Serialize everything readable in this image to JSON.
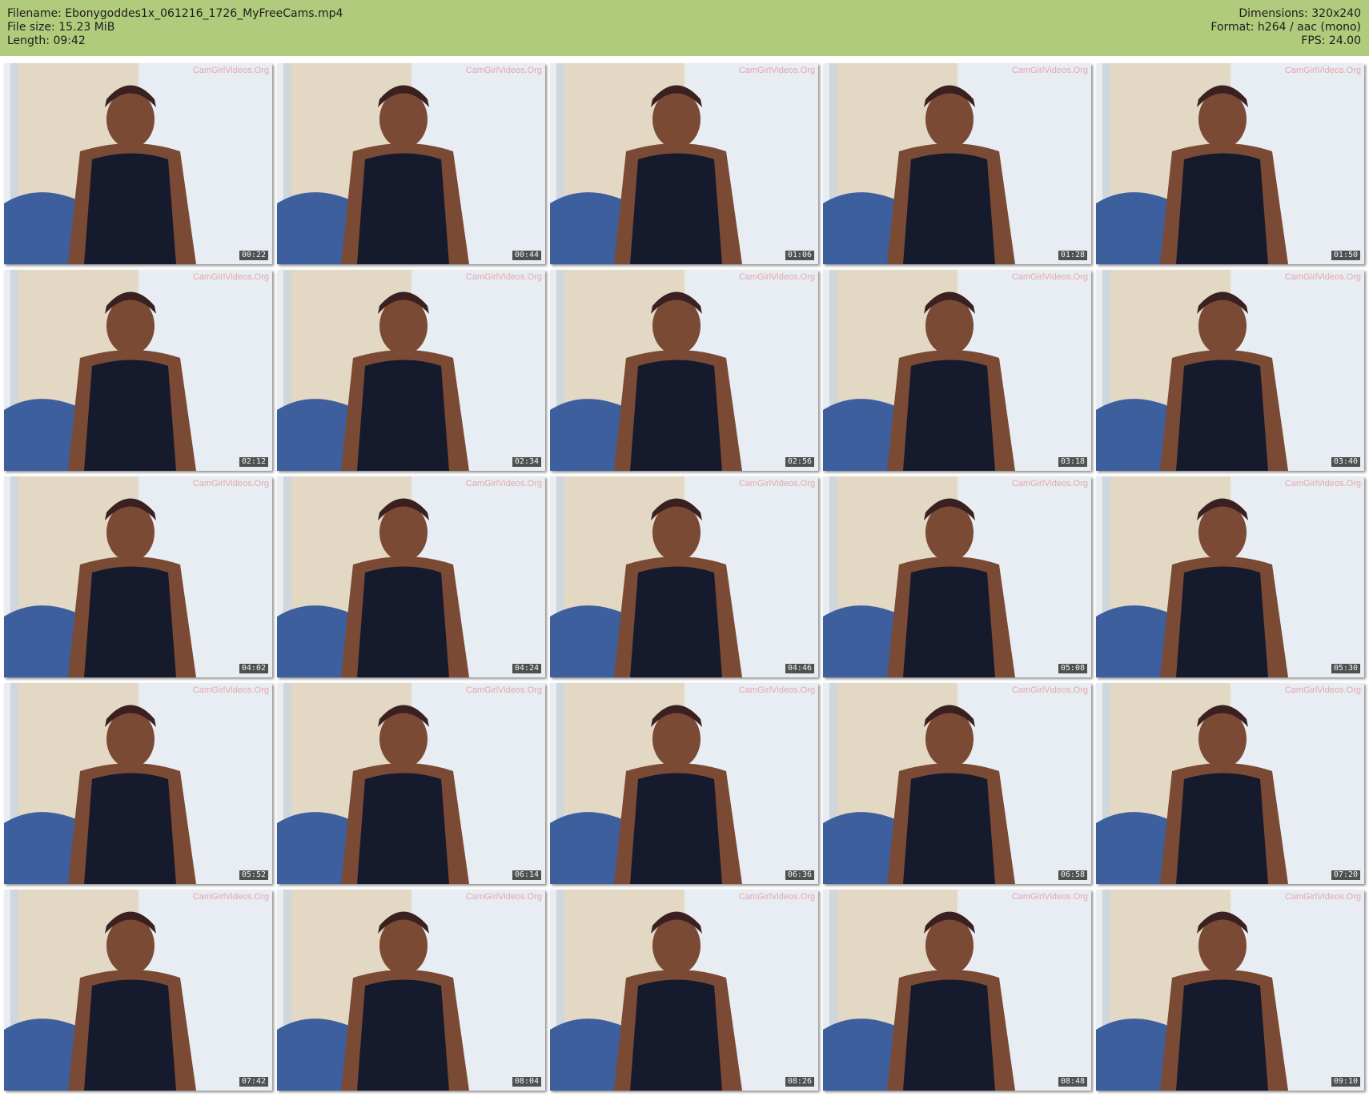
{
  "header": {
    "filename": "Filename: Ebonygoddes1x_061216_1726_MyFreeCams.mp4",
    "filesize": "File size: 15.23 MiB",
    "length": "Length: 09:42",
    "dimensions": "Dimensions: 320x240",
    "format": "Format: h264 / aac (mono)",
    "fps": "FPS: 24.00",
    "background_color": "#b0cb7c"
  },
  "watermark": "CamGirlVideos.Org",
  "thumbnails": [
    {
      "timestamp": "00:22"
    },
    {
      "timestamp": "00:44"
    },
    {
      "timestamp": "01:06"
    },
    {
      "timestamp": "01:28"
    },
    {
      "timestamp": "01:50"
    },
    {
      "timestamp": "02:12"
    },
    {
      "timestamp": "02:34"
    },
    {
      "timestamp": "02:56"
    },
    {
      "timestamp": "03:18"
    },
    {
      "timestamp": "03:40"
    },
    {
      "timestamp": "04:02"
    },
    {
      "timestamp": "04:24"
    },
    {
      "timestamp": "04:46"
    },
    {
      "timestamp": "05:08"
    },
    {
      "timestamp": "05:30"
    },
    {
      "timestamp": "05:52"
    },
    {
      "timestamp": "06:14"
    },
    {
      "timestamp": "06:36"
    },
    {
      "timestamp": "06:58"
    },
    {
      "timestamp": "07:20"
    },
    {
      "timestamp": "07:42"
    },
    {
      "timestamp": "08:04"
    },
    {
      "timestamp": "08:26"
    },
    {
      "timestamp": "08:48"
    },
    {
      "timestamp": "09:10"
    }
  ]
}
